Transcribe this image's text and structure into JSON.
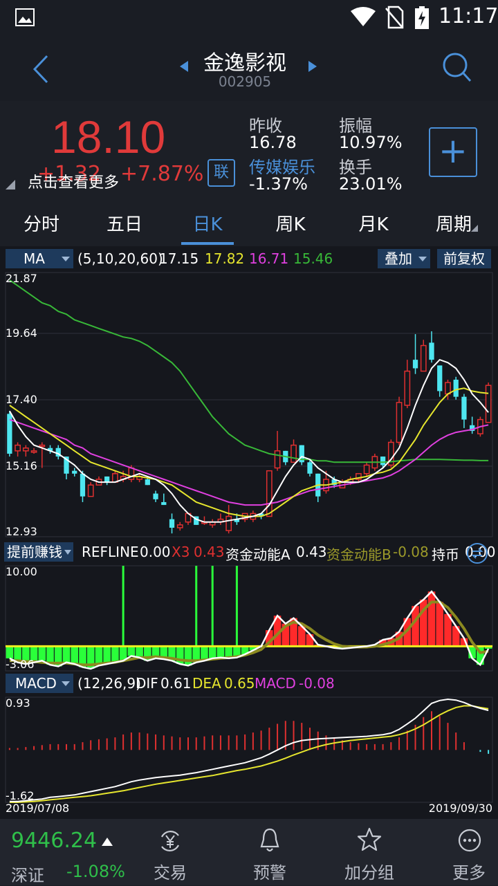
{
  "status": {
    "time": "11:17"
  },
  "header": {
    "title": "金逸影视",
    "code": "002905"
  },
  "quote": {
    "price": "18.10",
    "change": "+1.32",
    "change_pct": "+7.87%",
    "overlay_text": "点击查看更多",
    "lian_label": "联",
    "prev_close_label": "昨收",
    "prev_close": "16.78",
    "amplitude_label": "振幅",
    "amplitude": "10.97%",
    "sector_label": "传媒娱乐",
    "sector_change": "-1.37%",
    "turnover_label": "换手",
    "turnover": "23.01%",
    "add_button": "+"
  },
  "tabs": [
    {
      "label": "分时"
    },
    {
      "label": "五日"
    },
    {
      "label": "日K"
    },
    {
      "label": "周K"
    },
    {
      "label": "月K"
    },
    {
      "label": "周期"
    }
  ],
  "active_tab": "日K",
  "ma_bar": {
    "selector": "MA",
    "params": "(5,10,20,60)",
    "ma5": "17.15",
    "ma10": "17.82",
    "ma20": "16.71",
    "ma60": "15.46",
    "overlay_btn": "叠加",
    "adjust_btn": "前复权"
  },
  "colors": {
    "ma5": "#ffffff",
    "ma10": "#e6e62e",
    "ma20": "#e040e0",
    "ma60": "#38b838",
    "up": "#e03030",
    "down": "#4ee6f0",
    "accent": "#4a90d9"
  },
  "indicator_bar": {
    "selector": "提前赚钱",
    "refline_label": "REFLINE",
    "refline": "0.00",
    "x3_label": "X3",
    "x3": "0.43",
    "zja_label": "资金动能A",
    "zja": "0.43",
    "zjb_label": "资金动能B",
    "zjb": "-0.08",
    "cb_label": "持币",
    "cb": "0.00"
  },
  "macd_bar": {
    "selector": "MACD",
    "params": "(12,26,9)",
    "dif_label": "DIF",
    "dif": "0.61",
    "dea_label": "DEA",
    "dea": "0.65",
    "macd_label": "MACD",
    "macd": "-0.08"
  },
  "axis": {
    "k_ticks": [
      "21.87",
      "19.64",
      "17.40",
      "15.16",
      "12.93"
    ],
    "ind_ticks": [
      "10.00",
      "-3.06"
    ],
    "macd_ticks": [
      "0.93",
      "-1.62"
    ],
    "date_start": "2019/07/08",
    "date_end": "2019/09/30"
  },
  "bottom": {
    "index_value": "9446.24",
    "index_name": "深证",
    "index_change": "-1.08%",
    "nav": [
      {
        "label": "交易",
        "icon": "yen-exchange-icon"
      },
      {
        "label": "预警",
        "icon": "bell-icon"
      },
      {
        "label": "加分组",
        "icon": "star-icon"
      },
      {
        "label": "更多",
        "icon": "more-icon"
      }
    ]
  },
  "chart_data": {
    "type": "candlestick",
    "price_range": [
      12.93,
      21.87
    ],
    "candles": [
      [
        17.1,
        17.2,
        15.6,
        15.7
      ],
      [
        15.8,
        16.1,
        15.6,
        16.0
      ],
      [
        15.8,
        16.0,
        15.6,
        15.9
      ],
      [
        15.8,
        15.9,
        15.7,
        15.8
      ],
      [
        16.0,
        16.1,
        15.2,
        16.0
      ],
      [
        15.9,
        16.0,
        15.7,
        15.8
      ],
      [
        15.9,
        16.0,
        15.5,
        15.6
      ],
      [
        15.6,
        15.6,
        14.8,
        15.0
      ],
      [
        15.1,
        15.2,
        14.9,
        15.0
      ],
      [
        15.0,
        15.1,
        14.0,
        14.2
      ],
      [
        14.2,
        14.7,
        14.2,
        14.6
      ],
      [
        14.6,
        14.9,
        14.6,
        14.8
      ],
      [
        14.9,
        14.9,
        14.6,
        14.7
      ],
      [
        14.7,
        15.1,
        14.7,
        15.0
      ],
      [
        14.8,
        15.1,
        14.7,
        14.9
      ],
      [
        14.8,
        15.3,
        14.7,
        15.2
      ],
      [
        14.8,
        15.0,
        14.7,
        14.9
      ],
      [
        14.8,
        14.9,
        14.6,
        14.6
      ],
      [
        14.3,
        14.4,
        14.0,
        14.1
      ],
      [
        14.0,
        14.3,
        13.9,
        13.9
      ],
      [
        13.4,
        13.6,
        12.9,
        13.1
      ],
      [
        13.1,
        13.3,
        13.0,
        13.2
      ],
      [
        13.3,
        13.6,
        13.2,
        13.6
      ],
      [
        13.5,
        13.5,
        13.2,
        13.2
      ],
      [
        13.3,
        13.5,
        13.2,
        13.3
      ],
      [
        13.2,
        13.4,
        13.1,
        13.3
      ],
      [
        13.3,
        13.6,
        13.2,
        13.4
      ],
      [
        13.0,
        13.9,
        12.9,
        13.5
      ],
      [
        13.4,
        13.6,
        13.2,
        13.3
      ],
      [
        13.4,
        13.6,
        13.3,
        13.6
      ],
      [
        13.4,
        13.7,
        13.3,
        13.6
      ],
      [
        13.6,
        13.6,
        13.4,
        13.5
      ],
      [
        13.5,
        15.1,
        13.5,
        15.1
      ],
      [
        15.2,
        16.5,
        15.1,
        15.8
      ],
      [
        15.8,
        15.8,
        15.3,
        15.4
      ],
      [
        15.4,
        16.2,
        15.4,
        16.0
      ],
      [
        16.0,
        16.0,
        15.3,
        15.4
      ],
      [
        15.4,
        15.5,
        14.9,
        15.0
      ],
      [
        15.0,
        15.0,
        14.0,
        14.2
      ],
      [
        14.4,
        15.1,
        14.3,
        14.8
      ],
      [
        14.8,
        14.9,
        14.5,
        14.6
      ],
      [
        14.5,
        14.8,
        14.5,
        14.7
      ],
      [
        14.7,
        14.9,
        14.6,
        14.8
      ],
      [
        14.8,
        15.0,
        14.7,
        15.0
      ],
      [
        15.0,
        15.4,
        14.9,
        15.3
      ],
      [
        15.2,
        15.7,
        15.1,
        15.6
      ],
      [
        15.6,
        15.6,
        15.2,
        15.3
      ],
      [
        15.3,
        16.2,
        15.2,
        16.1
      ],
      [
        16.1,
        17.7,
        16.0,
        17.5
      ],
      [
        17.4,
        19.0,
        17.3,
        18.6
      ],
      [
        19.0,
        19.9,
        18.5,
        18.7
      ],
      [
        18.6,
        19.7,
        18.6,
        19.5
      ],
      [
        19.6,
        20.0,
        18.9,
        19.0
      ],
      [
        18.8,
        18.8,
        17.7,
        17.9
      ],
      [
        17.8,
        18.3,
        17.6,
        18.2
      ],
      [
        18.3,
        18.4,
        17.6,
        17.7
      ],
      [
        17.7,
        17.8,
        16.6,
        16.9
      ],
      [
        16.7,
        17.0,
        16.4,
        16.5
      ],
      [
        16.4,
        17.0,
        16.3,
        16.9
      ],
      [
        16.8,
        18.2,
        16.8,
        18.1
      ]
    ],
    "ma5": [
      17.2,
      16.7,
      16.3,
      16.0,
      15.9,
      15.8,
      15.7,
      15.5,
      15.3,
      15.0,
      14.8,
      14.7,
      14.7,
      14.7,
      14.8,
      14.9,
      15.0,
      14.9,
      14.8,
      14.6,
      14.3,
      13.9,
      13.6,
      13.4,
      13.3,
      13.3,
      13.3,
      13.35,
      13.4,
      13.45,
      13.5,
      13.6,
      13.9,
      14.4,
      14.9,
      15.3,
      15.6,
      15.5,
      15.2,
      15.0,
      14.8,
      14.7,
      14.7,
      14.7,
      14.8,
      15.0,
      15.2,
      15.5,
      15.9,
      16.6,
      17.4,
      18.1,
      18.7,
      19.0,
      18.9,
      18.7,
      18.3,
      17.8,
      17.5,
      17.15
    ],
    "ma10": [
      17.4,
      17.2,
      17.0,
      16.8,
      16.6,
      16.4,
      16.2,
      16.0,
      15.8,
      15.6,
      15.4,
      15.3,
      15.2,
      15.1,
      15.0,
      14.9,
      14.9,
      14.85,
      14.8,
      14.7,
      14.6,
      14.4,
      14.2,
      14.0,
      13.9,
      13.8,
      13.7,
      13.6,
      13.55,
      13.5,
      13.5,
      13.5,
      13.6,
      13.8,
      14.0,
      14.2,
      14.4,
      14.5,
      14.6,
      14.6,
      14.65,
      14.7,
      14.8,
      14.85,
      14.9,
      15.0,
      15.05,
      15.15,
      15.4,
      15.8,
      16.2,
      16.7,
      17.1,
      17.5,
      17.8,
      17.95,
      18.0,
      17.9,
      17.85,
      17.82
    ],
    "ma20": [
      16.9,
      16.8,
      16.7,
      16.6,
      16.5,
      16.4,
      16.3,
      16.2,
      16.0,
      15.9,
      15.7,
      15.6,
      15.5,
      15.4,
      15.3,
      15.2,
      15.1,
      15.0,
      14.9,
      14.8,
      14.7,
      14.6,
      14.5,
      14.4,
      14.3,
      14.2,
      14.1,
      14.0,
      13.95,
      13.9,
      13.9,
      13.9,
      13.95,
      14.0,
      14.1,
      14.2,
      14.3,
      14.4,
      14.45,
      14.5,
      14.55,
      14.6,
      14.65,
      14.7,
      14.75,
      14.8,
      14.85,
      14.95,
      15.1,
      15.3,
      15.5,
      15.75,
      16.0,
      16.2,
      16.35,
      16.45,
      16.5,
      16.55,
      16.65,
      16.71
    ],
    "ma60": [
      21.8,
      21.6,
      21.4,
      21.2,
      21.0,
      20.9,
      20.7,
      20.6,
      20.4,
      20.3,
      20.2,
      20.1,
      20.0,
      19.9,
      19.8,
      19.75,
      19.65,
      19.5,
      19.3,
      19.1,
      18.9,
      18.6,
      18.2,
      17.8,
      17.4,
      17.0,
      16.7,
      16.4,
      16.2,
      16.0,
      15.9,
      15.8,
      15.7,
      15.65,
      15.6,
      15.55,
      15.5,
      15.5,
      15.45,
      15.45,
      15.4,
      15.4,
      15.4,
      15.4,
      15.4,
      15.4,
      15.4,
      15.42,
      15.45,
      15.47,
      15.5,
      15.5,
      15.5,
      15.5,
      15.49,
      15.48,
      15.47,
      15.47,
      15.46,
      15.46
    ],
    "macd": {
      "range": [
        -1.62,
        0.93
      ],
      "dif": [
        -1.6,
        -1.6,
        -1.58,
        -1.56,
        -1.54,
        -1.5,
        -1.48,
        -1.46,
        -1.44,
        -1.4,
        -1.36,
        -1.32,
        -1.28,
        -1.24,
        -1.18,
        -1.12,
        -1.08,
        -1.05,
        -1.02,
        -1.0,
        -0.98,
        -0.96,
        -0.93,
        -0.9,
        -0.86,
        -0.82,
        -0.78,
        -0.74,
        -0.7,
        -0.66,
        -0.6,
        -0.54,
        -0.45,
        -0.35,
        -0.25,
        -0.17,
        -0.12,
        -0.1,
        -0.08,
        -0.07,
        -0.06,
        -0.05,
        -0.04,
        -0.03,
        -0.02,
        0.0,
        0.02,
        0.06,
        0.15,
        0.28,
        0.42,
        0.6,
        0.78,
        0.85,
        0.88,
        0.86,
        0.8,
        0.72,
        0.66,
        0.61
      ],
      "dea": [
        -1.62,
        -1.62,
        -1.61,
        -1.6,
        -1.58,
        -1.56,
        -1.54,
        -1.52,
        -1.5,
        -1.48,
        -1.46,
        -1.43,
        -1.4,
        -1.37,
        -1.34,
        -1.3,
        -1.26,
        -1.22,
        -1.18,
        -1.15,
        -1.12,
        -1.09,
        -1.06,
        -1.03,
        -1.0,
        -0.97,
        -0.93,
        -0.89,
        -0.85,
        -0.82,
        -0.78,
        -0.74,
        -0.68,
        -0.62,
        -0.55,
        -0.47,
        -0.4,
        -0.33,
        -0.27,
        -0.22,
        -0.18,
        -0.15,
        -0.12,
        -0.1,
        -0.08,
        -0.06,
        -0.04,
        -0.02,
        0.02,
        0.08,
        0.16,
        0.26,
        0.38,
        0.5,
        0.6,
        0.68,
        0.72,
        0.72,
        0.68,
        0.65
      ],
      "hist": [
        0.02,
        0.02,
        0.03,
        0.04,
        0.05,
        0.06,
        0.06,
        0.06,
        0.06,
        0.08,
        0.1,
        0.11,
        0.12,
        0.13,
        0.16,
        0.18,
        0.18,
        0.17,
        0.16,
        0.15,
        0.14,
        0.13,
        0.13,
        0.13,
        0.14,
        0.15,
        0.15,
        0.15,
        0.15,
        0.16,
        0.18,
        0.2,
        0.23,
        0.27,
        0.3,
        0.3,
        0.28,
        0.23,
        0.19,
        0.15,
        0.12,
        0.1,
        0.08,
        0.07,
        0.06,
        0.06,
        0.06,
        0.08,
        0.13,
        0.2,
        0.26,
        0.34,
        0.4,
        0.35,
        0.28,
        0.18,
        0.08,
        0.0,
        -0.02,
        -0.04
      ]
    },
    "indicator": {
      "range": [
        -3.06,
        10.0
      ],
      "main": [
        -1.5,
        -2.0,
        -2.2,
        -2.0,
        -1.8,
        -2.3,
        -2.5,
        -2.0,
        -2.2,
        -2.6,
        -2.8,
        -2.4,
        -2.2,
        -2.0,
        -1.8,
        -1.2,
        -1.4,
        -1.8,
        -1.5,
        -1.6,
        -1.8,
        -2.2,
        -2.4,
        -2.0,
        -1.8,
        -1.5,
        -1.4,
        -1.5,
        -1.4,
        -1.0,
        -0.5,
        0.0,
        2.0,
        3.8,
        2.8,
        3.5,
        2.5,
        1.5,
        0.2,
        0.0,
        -0.2,
        -0.3,
        -0.2,
        -0.1,
        0.0,
        0.2,
        0.8,
        1.0,
        1.8,
        3.5,
        5.0,
        5.8,
        6.8,
        5.5,
        4.0,
        2.5,
        1.0,
        -1.5,
        -2.3,
        -0.3
      ],
      "signal": [
        -1.8,
        -1.8,
        -1.9,
        -1.9,
        -2.0,
        -2.1,
        -2.1,
        -2.1,
        -2.2,
        -2.3,
        -2.3,
        -2.2,
        -2.1,
        -2.0,
        -1.8,
        -1.6,
        -1.4,
        -1.4,
        -1.3,
        -1.4,
        -1.5,
        -1.7,
        -1.8,
        -1.8,
        -1.7,
        -1.6,
        -1.5,
        -1.4,
        -1.3,
        -1.1,
        -0.8,
        -0.4,
        0.5,
        1.5,
        2.5,
        3.0,
        2.8,
        2.2,
        1.4,
        0.8,
        0.3,
        0.0,
        -0.1,
        -0.1,
        -0.1,
        0.0,
        0.2,
        0.5,
        1.0,
        2.0,
        3.2,
        4.5,
        5.5,
        5.5,
        4.8,
        3.6,
        2.2,
        0.5,
        -0.8,
        -0.6
      ],
      "spikes": [
        14,
        23,
        25,
        28
      ]
    }
  }
}
